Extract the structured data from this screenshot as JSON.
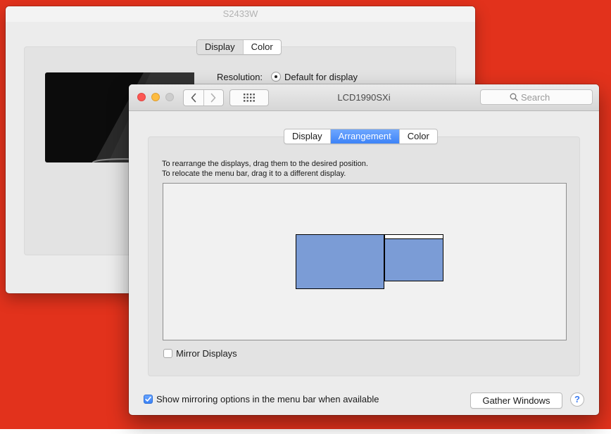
{
  "back_window": {
    "title": "S2433W",
    "tabs": [
      {
        "label": "Display",
        "selected": true
      },
      {
        "label": "Color",
        "selected": false
      }
    ],
    "resolution_label": "Resolution:",
    "resolution_value": "Default for display"
  },
  "front_window": {
    "title": "LCD1990SXi",
    "search_placeholder": "Search",
    "tabs": [
      {
        "label": "Display",
        "selected": false
      },
      {
        "label": "Arrangement",
        "selected": true
      },
      {
        "label": "Color",
        "selected": false
      }
    ],
    "instructions": [
      "To rearrange the displays, drag them to the desired position.",
      "To relocate the menu bar, drag it to a different display."
    ],
    "mirror_displays": {
      "label": "Mirror Displays",
      "checked": false
    },
    "show_mirroring": {
      "label": "Show mirroring options in the menu bar when available",
      "checked": true
    },
    "gather_windows_label": "Gather Windows",
    "help_label": "?"
  },
  "colors": {
    "desktop": "#e2321c",
    "accent": "#3d83f7",
    "display_block": "#7b9cd6"
  },
  "icons": [
    "close-icon",
    "minimize-icon",
    "zoom-icon",
    "back-chevron-icon",
    "forward-chevron-icon",
    "show-all-grid-icon",
    "search-icon",
    "checkmark-icon"
  ]
}
